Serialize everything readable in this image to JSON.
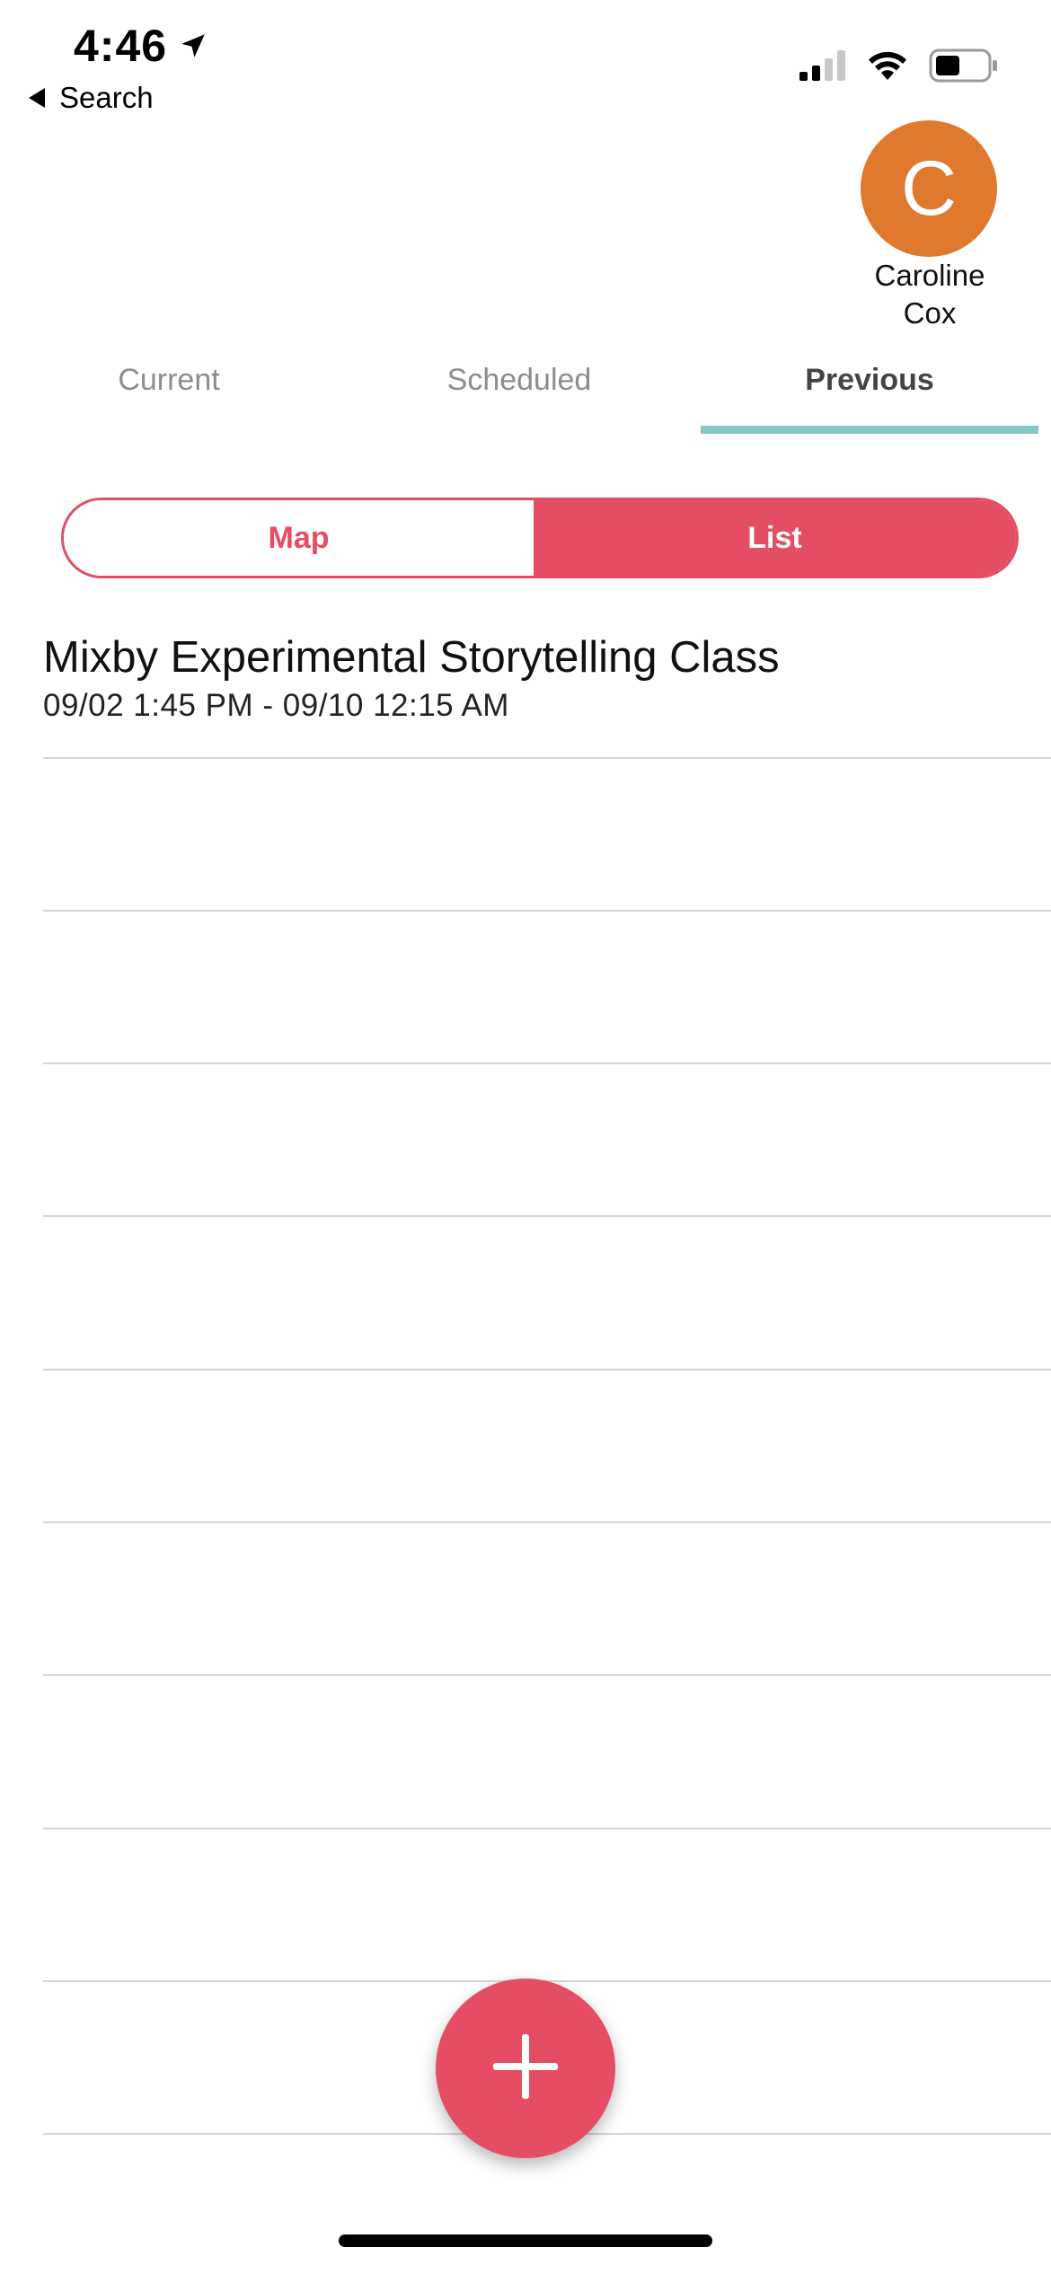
{
  "status_bar": {
    "time": "4:46",
    "back_label": "Search"
  },
  "profile": {
    "initial": "C",
    "name_first": "Caroline",
    "name_last": "Cox",
    "avatar_color": "#e0782d"
  },
  "tabs": [
    {
      "label": "Current",
      "active": false
    },
    {
      "label": "Scheduled",
      "active": false
    },
    {
      "label": "Previous",
      "active": true
    }
  ],
  "view_toggle": {
    "map_label": "Map",
    "list_label": "List",
    "selected": "List"
  },
  "items": [
    {
      "title": "Mixby Experimental Storytelling Class",
      "dates": "09/02 1:45 PM - 09/10 12:15 AM"
    }
  ],
  "colors": {
    "accent": "#e44d63",
    "tab_indicator": "#84c8c4",
    "divider": "#d6d6d6"
  },
  "icons": {
    "location": "location-arrow-icon",
    "signal": "cellular-signal-icon",
    "wifi": "wifi-icon",
    "battery": "battery-icon",
    "add": "plus-icon"
  }
}
